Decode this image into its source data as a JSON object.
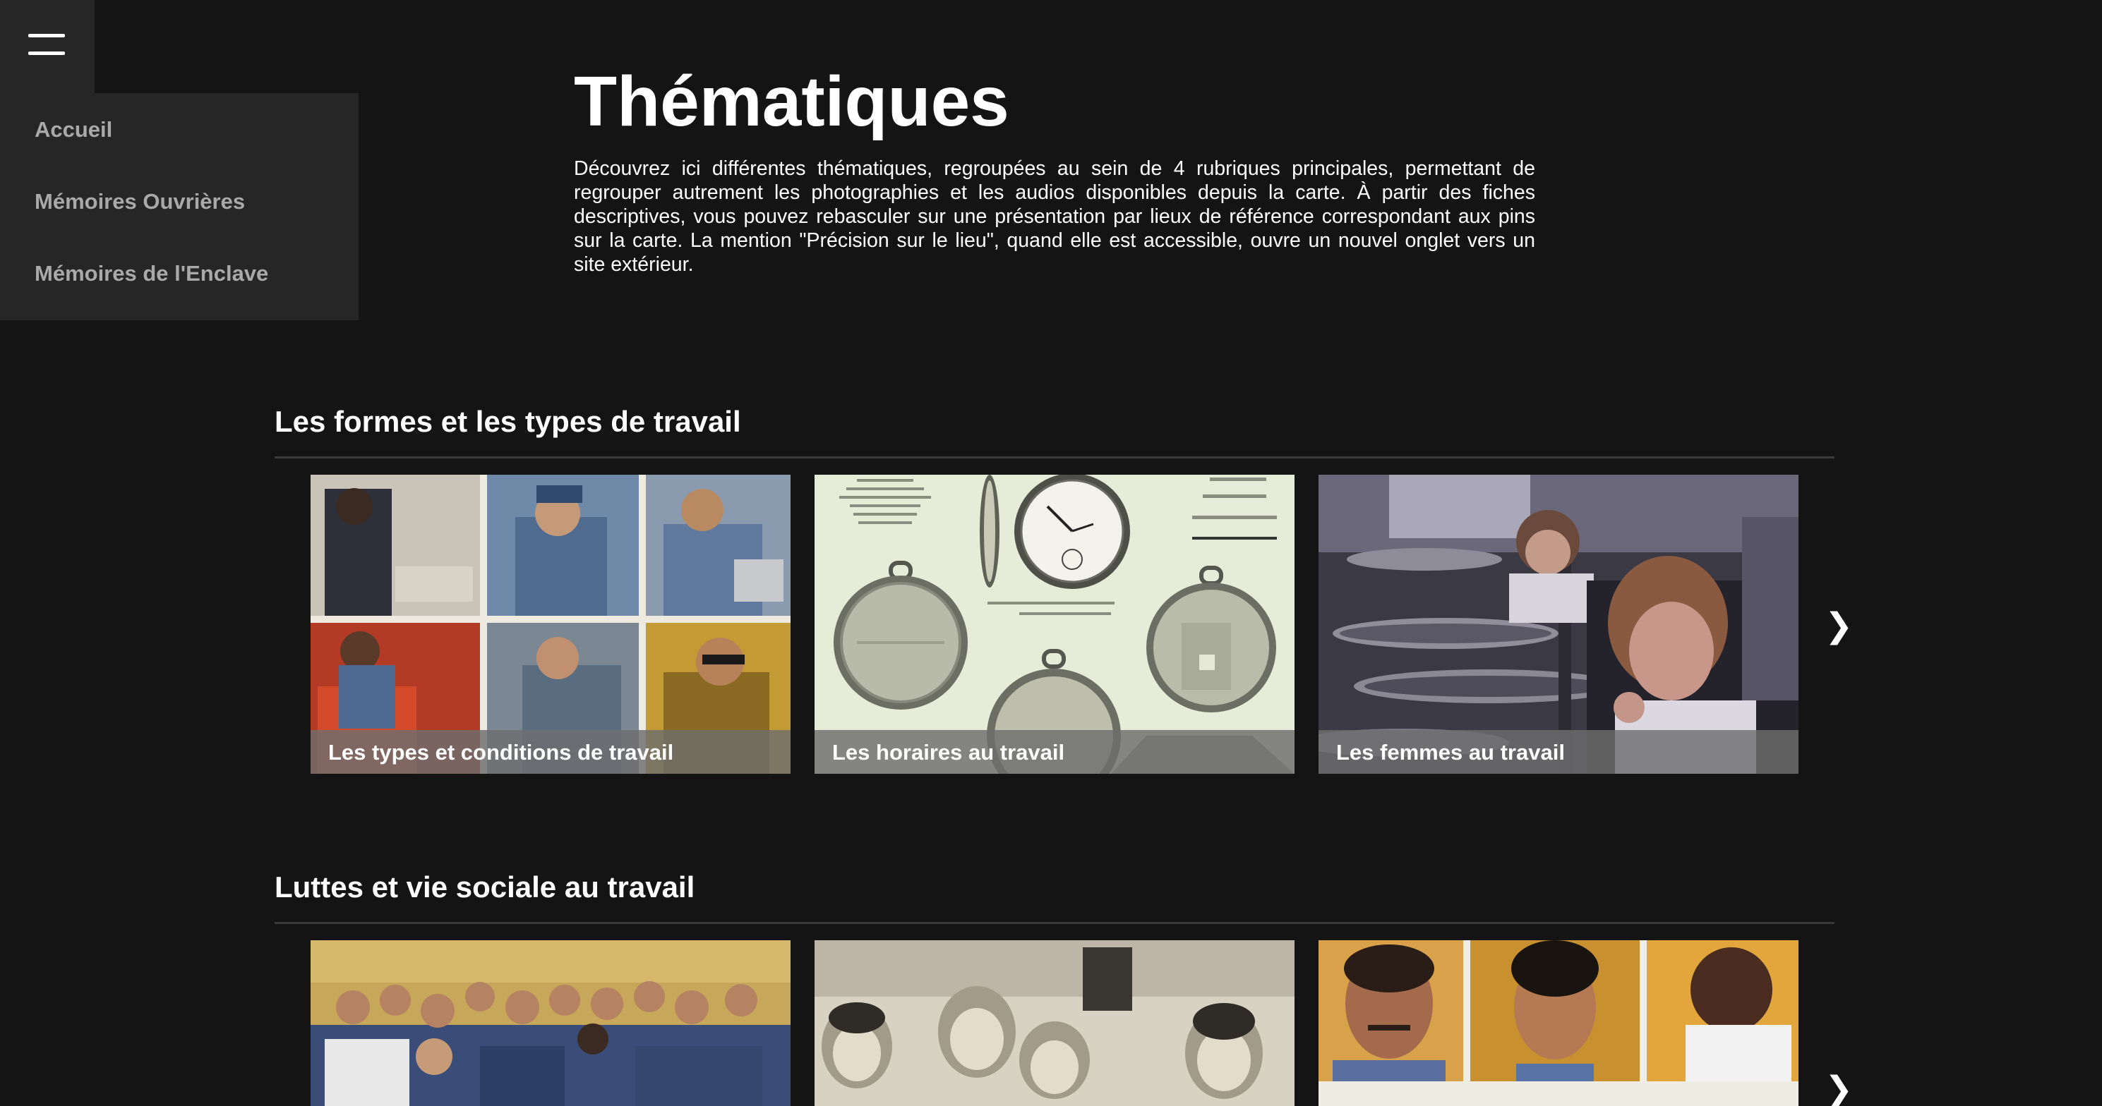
{
  "nav": {
    "items": [
      {
        "label": "Accueil"
      },
      {
        "label": "Mémoires Ouvrières"
      },
      {
        "label": "Mémoires de l'Enclave"
      }
    ]
  },
  "header": {
    "title": "Thématiques",
    "intro": "Découvrez ici différentes thématiques, regroupées au sein de 4 rubriques principales, permettant de regrouper autrement les photographies et les audios disponibles depuis la carte. À partir des fiches descriptives, vous pouvez rebasculer sur une présentation par lieux de référence correspondant aux pins sur la carte. La mention \"Précision sur le lieu\", quand elle est accessible, ouvre un nouvel onglet vers un site extérieur."
  },
  "sections": [
    {
      "title": "Les formes et les types de travail",
      "cards": [
        {
          "caption": "Les types et conditions de travail"
        },
        {
          "caption": "Les horaires au travail"
        },
        {
          "caption": "Les femmes au travail"
        }
      ],
      "next_glyph": "❯"
    },
    {
      "title": "Luttes et vie sociale au travail",
      "cards": [
        {
          "caption": ""
        },
        {
          "caption": ""
        },
        {
          "caption": ""
        }
      ],
      "next_glyph": "❯"
    }
  ],
  "colors": {
    "background": "#141414",
    "panel": "#262626",
    "nav_text": "#a9a9a9",
    "rule": "#3a3a3a"
  },
  "icons": {
    "menu": "hamburger-icon",
    "next": "chevron-right-icon"
  }
}
